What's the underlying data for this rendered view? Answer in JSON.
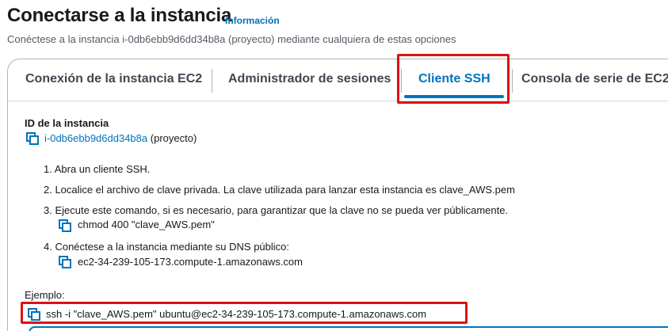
{
  "header": {
    "title": "Conectarse a la instancia",
    "info_link": "Información",
    "subtitle": "Conéctese a la instancia i-0db6ebb9d6dd34b8a (proyecto) mediante cualquiera de estas opciones"
  },
  "tabs": [
    {
      "label": "Conexión de la instancia EC2",
      "active": false
    },
    {
      "label": "Administrador de sesiones",
      "active": false
    },
    {
      "label": "Cliente SSH",
      "active": true
    },
    {
      "label": "Consola de serie de EC2",
      "active": false
    }
  ],
  "instance": {
    "heading": "ID de la instancia",
    "id": "i-0db6ebb9d6dd34b8a",
    "name_suffix": "(proyecto)"
  },
  "steps": [
    {
      "text": "1. Abra un cliente SSH."
    },
    {
      "text": "2. Localice el archivo de clave privada. La clave utilizada para lanzar esta instancia es clave_AWS.pem"
    },
    {
      "text": "3. Ejecute este comando, si es necesario, para garantizar que la clave no se pueda ver públicamente.",
      "command": "chmod 400 \"clave_AWS.pem\""
    },
    {
      "text": "4. Conéctese a la instancia mediante su DNS público:",
      "command": "ec2-34-239-105-173.compute-1.amazonaws.com"
    }
  ],
  "example": {
    "label": "Ejemplo:",
    "command": "ssh -i \"clave_AWS.pem\" ubuntu@ec2-34-239-105-173.compute-1.amazonaws.com"
  },
  "colors": {
    "accent": "#0073bb",
    "highlight": "#e01010",
    "text": "#16191f"
  }
}
